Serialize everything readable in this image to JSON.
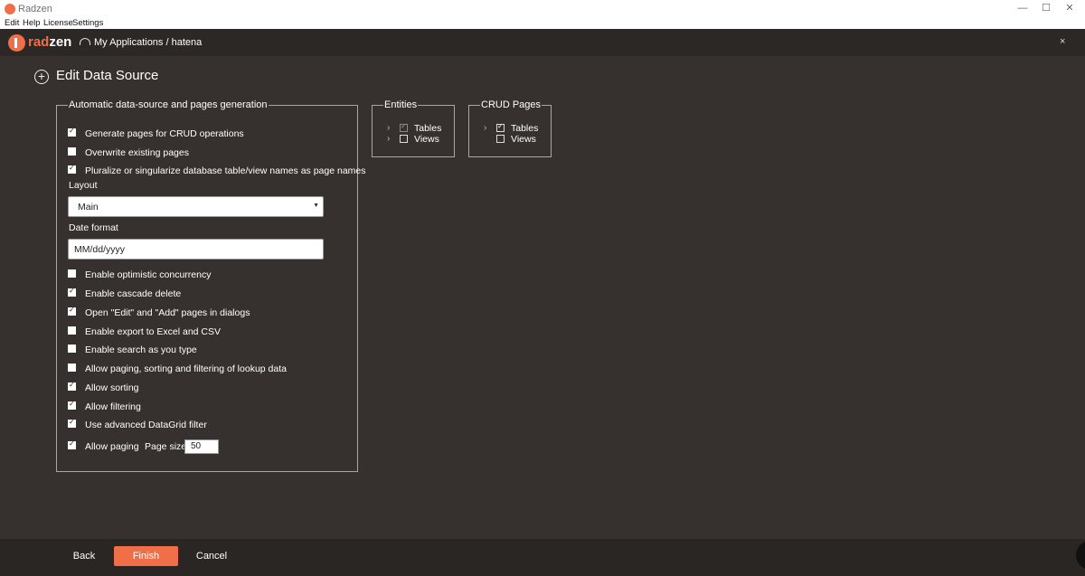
{
  "window": {
    "title": "Radzen",
    "minimize": "—",
    "maximize": "☐",
    "close": "✕"
  },
  "menu": [
    "Edit",
    "Help",
    "License",
    "Settings"
  ],
  "appbar": {
    "brand_rad": "rad",
    "brand_zen": "zen",
    "path": "My Applications / hatena",
    "close": "×"
  },
  "page": {
    "title": "Edit Data Source"
  },
  "generation": {
    "legend": "Automatic data-source and pages generation",
    "options_top": [
      {
        "label": "Generate pages for CRUD operations",
        "checked": true
      },
      {
        "label": "Overwrite existing pages",
        "checked": false
      },
      {
        "label": "Pluralize or singularize database table/view names as page names",
        "checked": true
      }
    ],
    "layout_label": "Layout",
    "layout_value": "Main",
    "date_label": "Date format",
    "date_value": "MM/dd/yyyy",
    "options_bottom": [
      {
        "label": "Enable optimistic concurrency",
        "checked": false
      },
      {
        "label": "Enable cascade delete",
        "checked": true
      },
      {
        "label": "Open \"Edit\" and \"Add\" pages in dialogs",
        "checked": true
      },
      {
        "label": "Enable export to Excel and CSV",
        "checked": false
      },
      {
        "label": "Enable search as you type",
        "checked": false
      },
      {
        "label": "Allow paging, sorting and filtering of lookup data",
        "checked": false
      },
      {
        "label": "Allow sorting",
        "checked": true
      },
      {
        "label": "Allow filtering",
        "checked": true
      },
      {
        "label": "Use advanced DataGrid filter",
        "checked": true
      }
    ],
    "paging": {
      "label": "Allow paging",
      "checked": true,
      "page_size_label": "Page size",
      "page_size": "50"
    }
  },
  "entities": {
    "legend": "Entities",
    "items": [
      {
        "label": "Tables",
        "checked": true
      },
      {
        "label": "Views",
        "checked": false
      }
    ]
  },
  "crud_pages": {
    "legend": "CRUD Pages",
    "items": [
      {
        "label": "Tables",
        "checked": true
      },
      {
        "label": "Views",
        "checked": false
      }
    ]
  },
  "footer": {
    "back": "Back",
    "finish": "Finish",
    "cancel": "Cancel"
  },
  "colors": {
    "accent": "#f06f48",
    "background": "#36312e",
    "header": "#2c2826"
  }
}
